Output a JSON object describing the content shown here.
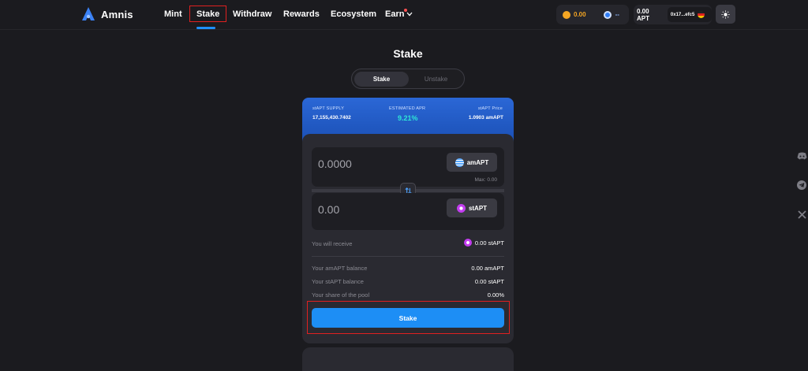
{
  "brand": {
    "name": "Amnis"
  },
  "nav": {
    "items": [
      {
        "label": "Mint"
      },
      {
        "label": "Stake"
      },
      {
        "label": "Withdraw"
      },
      {
        "label": "Rewards"
      },
      {
        "label": "Ecosystem"
      },
      {
        "label": "Earn"
      }
    ]
  },
  "wallet": {
    "points": "0.00",
    "dash": "--",
    "apt_balance": "0.00 APT",
    "address": "0x17...efc5"
  },
  "page": {
    "title": "Stake"
  },
  "toggle": {
    "stake": "Stake",
    "unstake": "Unstake"
  },
  "stats": {
    "supply_label": "stAPT SUPPLY",
    "supply_value": "17,155,430.7402",
    "apr_label": "ESTIMATED APR",
    "apr_value": "9.21%",
    "price_label": "stAPT Price",
    "price_value": "1.0903 amAPT"
  },
  "swap": {
    "from_value": "0.0000",
    "from_token": "amAPT",
    "max_label": "Max: 0.00",
    "to_value": "0.00",
    "to_token": "stAPT"
  },
  "details": {
    "receive_label": "You will receive",
    "receive_value": "0.00 stAPT",
    "amapt_balance_label": "Your amAPT balance",
    "amapt_balance_value": "0.00 amAPT",
    "stapt_balance_label": "Your stAPT balance",
    "stapt_balance_value": "0.00 stAPT",
    "share_label": "Your share of the pool",
    "share_value": "0.00%"
  },
  "actions": {
    "stake": "Stake"
  },
  "colors": {
    "accent": "#1d8ef5",
    "apr": "#2ee6d6",
    "highlight": "#e02020"
  },
  "icons": [
    "amnis-logo-icon",
    "chevron-down-icon",
    "coin-icon",
    "aptos-icon",
    "flag-icon",
    "sun-icon",
    "swap-arrows-icon",
    "amapt-token-icon",
    "stapt-token-icon",
    "discord-icon",
    "telegram-icon",
    "x-icon"
  ]
}
